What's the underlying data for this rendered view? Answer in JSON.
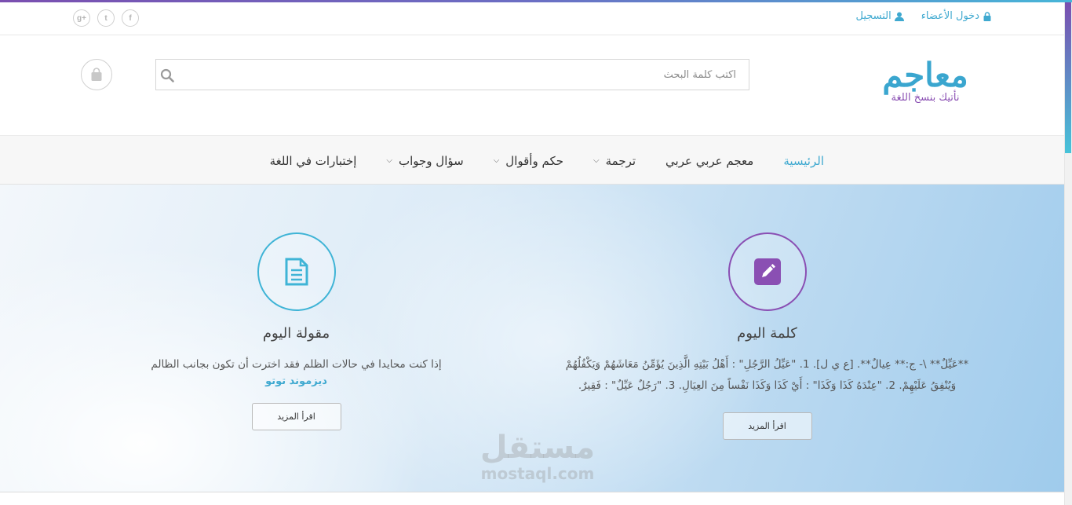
{
  "topbar": {
    "register_label": "التسجيل",
    "login_label": "دخول الأعضاء",
    "socials": [
      "g+",
      "t",
      "f"
    ]
  },
  "header": {
    "logo_text": "معاجم",
    "logo_tagline": "نأتيك بنسخ اللغة",
    "search_placeholder": "اكتب كلمة البحث"
  },
  "nav": {
    "items": [
      {
        "label": "الرئيسية",
        "active": true
      },
      {
        "label": "معجم عربي عربي"
      },
      {
        "label": "ترجمة"
      },
      {
        "label": "حكم وأقوال"
      },
      {
        "label": "سؤال وجواب"
      },
      {
        "label": "إختبارات في اللغة"
      }
    ]
  },
  "word_of_day": {
    "title": "كلمة اليوم",
    "line1": "**عَيِّلٌ** \\- ج:** عِيالٌ**. [ع ي ل]. 1. \"عَيِّلُ الرَّجُلِ\" : أَهْلُ بَيْتِهِ الَّذِينَ يُؤَمِّنُ مَعَاشَهُمْ وَيَكْفُلُهُمْ",
    "line2": "وَيُنْفِقُ عَلَيْهِمْ. 2. \"عِنْدَهُ كَذَا وَكَذَا\" : أَيْ كَذَا وَكَذَا نَفْساً مِنَ العِيَالِ. 3. \"رَجُلٌ عَيِّلٌ\" : فَقِيرٌ.",
    "button": "اقرأ المزيد"
  },
  "quote_of_day": {
    "title": "مقولة اليوم",
    "text": "إذا كنت محايدا في حالات الظلم فقد اخترت أن تكون بجانب الظالم",
    "author": "ديزموند توتو",
    "button": "اقرأ المزيد"
  },
  "watermark": {
    "arabic": "مستقل",
    "latin": "mostaql.com"
  },
  "colors": {
    "accent_blue": "#3fa9d0",
    "accent_purple": "#8a4fb3"
  }
}
